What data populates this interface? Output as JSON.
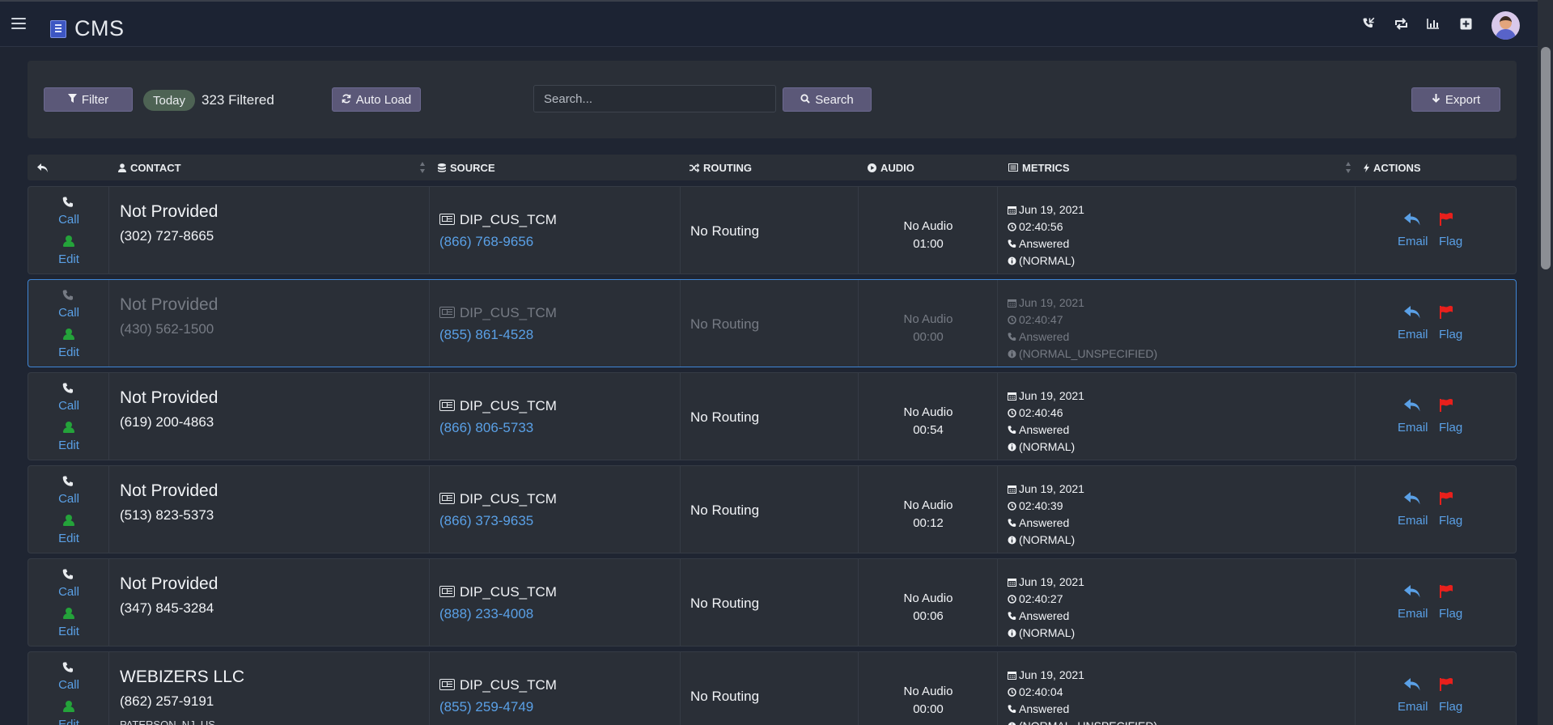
{
  "app": {
    "title": "CMS"
  },
  "nav_icons": [
    "phone-incoming-icon",
    "retweet-icon",
    "bar-chart-icon",
    "plus-square-icon"
  ],
  "toolbar": {
    "filter_label": "Filter",
    "today_badge": "Today",
    "filtered_count": "323 Filtered",
    "autoload_label": "Auto Load",
    "search_placeholder": "Search...",
    "search_label": "Search",
    "export_label": "Export"
  },
  "table": {
    "headers": {
      "contact": "CONTACT",
      "source": "SOURCE",
      "routing": "ROUTING",
      "audio": "AUDIO",
      "metrics": "METRICS",
      "actions": "ACTIONS"
    },
    "call_label": "Call",
    "edit_label": "Edit",
    "email_label": "Email",
    "flag_label": "Flag",
    "rows": [
      {
        "name": "Not Provided",
        "phone": "(302) 727-8665",
        "location": "",
        "source_name": "DIP_CUS_TCM",
        "source_phone": "(866) 768-9656",
        "routing": "No Routing",
        "audio": "No Audio",
        "audio_time": "01:00",
        "date": "Jun 19, 2021",
        "time": "02:40:56",
        "status": "Answered",
        "result": "(NORMAL)",
        "selected": false
      },
      {
        "name": "Not Provided",
        "phone": "(430) 562-1500",
        "location": "",
        "source_name": "DIP_CUS_TCM",
        "source_phone": "(855) 861-4528",
        "routing": "No Routing",
        "audio": "No Audio",
        "audio_time": "00:00",
        "date": "Jun 19, 2021",
        "time": "02:40:47",
        "status": "Answered",
        "result": "(NORMAL_UNSPECIFIED)",
        "selected": true
      },
      {
        "name": "Not Provided",
        "phone": "(619) 200-4863",
        "location": "",
        "source_name": "DIP_CUS_TCM",
        "source_phone": "(866) 806-5733",
        "routing": "No Routing",
        "audio": "No Audio",
        "audio_time": "00:54",
        "date": "Jun 19, 2021",
        "time": "02:40:46",
        "status": "Answered",
        "result": "(NORMAL)",
        "selected": false
      },
      {
        "name": "Not Provided",
        "phone": "(513) 823-5373",
        "location": "",
        "source_name": "DIP_CUS_TCM",
        "source_phone": "(866) 373-9635",
        "routing": "No Routing",
        "audio": "No Audio",
        "audio_time": "00:12",
        "date": "Jun 19, 2021",
        "time": "02:40:39",
        "status": "Answered",
        "result": "(NORMAL)",
        "selected": false
      },
      {
        "name": "Not Provided",
        "phone": "(347) 845-3284",
        "location": "",
        "source_name": "DIP_CUS_TCM",
        "source_phone": "(888) 233-4008",
        "routing": "No Routing",
        "audio": "No Audio",
        "audio_time": "00:06",
        "date": "Jun 19, 2021",
        "time": "02:40:27",
        "status": "Answered",
        "result": "(NORMAL)",
        "selected": false
      },
      {
        "name": "WEBIZERS LLC",
        "phone": "(862) 257-9191",
        "location": "PATERSON, NJ, US",
        "source_name": "DIP_CUS_TCM",
        "source_phone": "(855) 259-4749",
        "routing": "No Routing",
        "audio": "No Audio",
        "audio_time": "00:00",
        "date": "Jun 19, 2021",
        "time": "02:40:04",
        "status": "Answered",
        "result": "(NORMAL_UNSPECIFIED)",
        "selected": false
      }
    ]
  },
  "colors": {
    "link": "#5aa0e6",
    "edit_icon": "#24a33a",
    "flag": "#e8201c",
    "selected_border": "#3f86d6",
    "button": "#5b5878"
  }
}
